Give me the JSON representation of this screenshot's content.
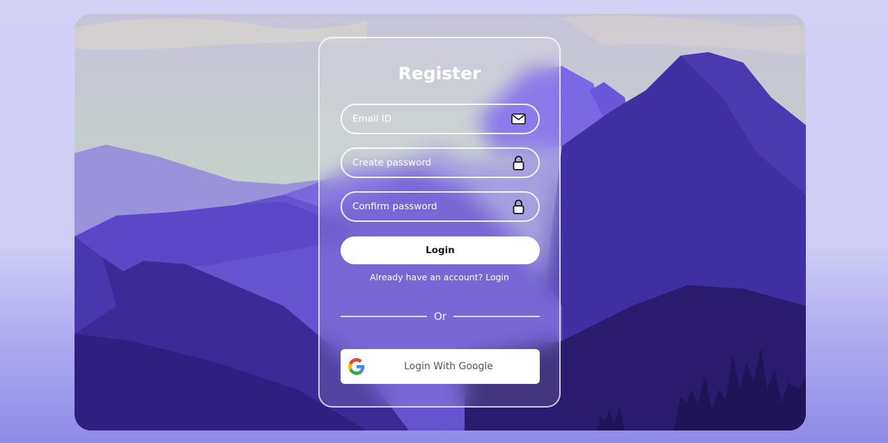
{
  "form": {
    "title": "Register",
    "email": {
      "placeholder": "Email ID",
      "icon": "envelope-icon"
    },
    "password": {
      "placeholder": "Create password",
      "icon": "lock-icon"
    },
    "confirm": {
      "placeholder": "Confirm password",
      "icon": "lock-icon"
    },
    "login_label": "Login",
    "already_text": "Already have an account? Login",
    "divider_text": "Or",
    "google_label": "Login With Google",
    "google_icon": "google-icon"
  },
  "colors": {
    "accent": "#6f5ce8",
    "background": "#d3d1f6",
    "button": "#ffffff"
  }
}
